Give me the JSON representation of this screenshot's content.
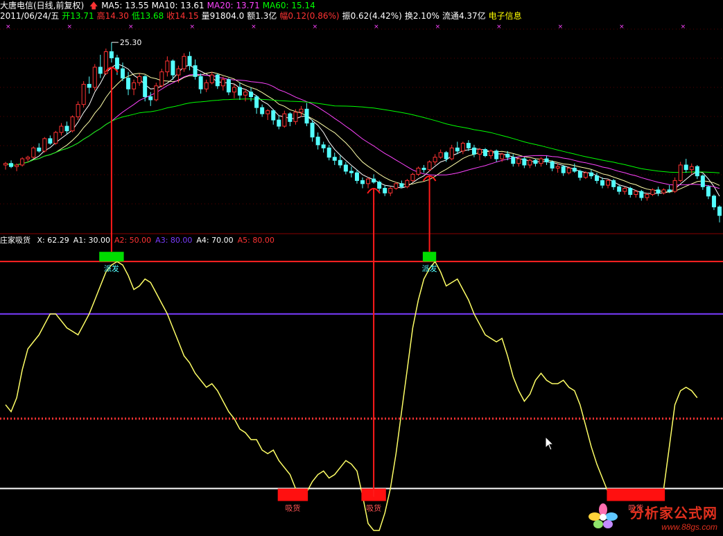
{
  "header": {
    "title": "大唐电信(日线,前复权)",
    "ma": [
      {
        "label": "MA5: 13.55",
        "color": "#ffffff"
      },
      {
        "label": "MA10: 13.61",
        "color": "#ffffff"
      },
      {
        "label": "MA20: 13.71",
        "color": "#ff44ff"
      },
      {
        "label": "MA60: 15.14",
        "color": "#00ff00"
      }
    ],
    "quote": [
      {
        "label": "2011/06/24/五",
        "color": "#ffffff"
      },
      {
        "label": "开13.71",
        "color": "#00ff00"
      },
      {
        "label": "高14.30",
        "color": "#ff3333"
      },
      {
        "label": "低13.68",
        "color": "#00ff00"
      },
      {
        "label": "收14.15",
        "color": "#ff3333"
      },
      {
        "label": "量91804.0",
        "color": "#ffffff"
      },
      {
        "label": "额1.3亿",
        "color": "#ffffff"
      },
      {
        "label": "幅0.12(0.86%)",
        "color": "#ff3333"
      },
      {
        "label": "振0.62(4.42%)",
        "color": "#ffffff"
      },
      {
        "label": "换2.10%",
        "color": "#ffffff"
      },
      {
        "label": "流通4.37亿",
        "color": "#ffffff"
      },
      {
        "label": "电子信息",
        "color": "#ffff00"
      }
    ],
    "peak_label": "25.30"
  },
  "indicator": {
    "title": "庄家吸货",
    "params": [
      {
        "label": "X: 62.29",
        "color": "#ffffff"
      },
      {
        "label": "A1: 30.00",
        "color": "#ffffff"
      },
      {
        "label": "A2: 50.00",
        "color": "#ff3333"
      },
      {
        "label": "A3: 80.00",
        "color": "#7b3cff"
      },
      {
        "label": "A4: 70.00",
        "color": "#ffffff"
      },
      {
        "label": "A5: 80.00",
        "color": "#ff3333"
      }
    ]
  },
  "signals": {
    "sell_text": "派发",
    "buy_text": "吸货"
  },
  "watermark": {
    "name": "分析家公式网",
    "url": "www.88gs.com"
  },
  "chart_data": {
    "type": "candlestick",
    "candles": [
      [
        17.4,
        17.6,
        17.1,
        17.5
      ],
      [
        17.5,
        17.7,
        17.2,
        17.3
      ],
      [
        17.3,
        17.5,
        17.0,
        17.4
      ],
      [
        17.4,
        17.9,
        17.3,
        17.8
      ],
      [
        17.8,
        18.0,
        17.6,
        17.9
      ],
      [
        17.9,
        18.6,
        17.8,
        18.5
      ],
      [
        18.5,
        18.8,
        18.2,
        18.3
      ],
      [
        18.3,
        19.2,
        18.2,
        19.1
      ],
      [
        19.1,
        19.3,
        18.7,
        18.8
      ],
      [
        18.8,
        19.6,
        18.7,
        19.5
      ],
      [
        19.5,
        20.1,
        19.3,
        19.9
      ],
      [
        19.9,
        20.2,
        19.4,
        19.6
      ],
      [
        19.6,
        20.6,
        19.5,
        20.5
      ],
      [
        20.5,
        21.5,
        20.3,
        21.3
      ],
      [
        21.3,
        22.8,
        21.1,
        22.6
      ],
      [
        22.6,
        23.1,
        22.0,
        22.4
      ],
      [
        22.4,
        23.9,
        22.2,
        23.7
      ],
      [
        23.7,
        24.5,
        23.0,
        23.3
      ],
      [
        23.3,
        24.9,
        23.2,
        24.7
      ],
      [
        24.7,
        25.3,
        24.0,
        24.3
      ],
      [
        24.3,
        24.5,
        23.2,
        23.6
      ],
      [
        23.6,
        24.0,
        22.8,
        23.0
      ],
      [
        23.0,
        23.4,
        21.9,
        22.3
      ],
      [
        22.3,
        22.9,
        21.9,
        22.7
      ],
      [
        22.7,
        23.3,
        22.5,
        23.1
      ],
      [
        23.1,
        23.2,
        21.5,
        21.8
      ],
      [
        21.8,
        22.1,
        21.2,
        21.6
      ],
      [
        21.6,
        22.7,
        21.5,
        22.5
      ],
      [
        22.5,
        23.6,
        22.4,
        23.4
      ],
      [
        23.4,
        24.4,
        23.1,
        24.1
      ],
      [
        24.1,
        24.2,
        22.9,
        23.2
      ],
      [
        23.2,
        23.8,
        22.7,
        23.6
      ],
      [
        23.6,
        24.6,
        23.4,
        24.4
      ],
      [
        24.4,
        24.7,
        23.5,
        23.8
      ],
      [
        23.8,
        24.2,
        22.9,
        23.1
      ],
      [
        23.1,
        23.3,
        22.0,
        22.3
      ],
      [
        22.3,
        22.9,
        22.1,
        22.7
      ],
      [
        22.7,
        23.4,
        22.6,
        23.2
      ],
      [
        23.2,
        23.3,
        22.3,
        22.5
      ],
      [
        22.5,
        23.1,
        22.2,
        22.9
      ],
      [
        22.9,
        23.0,
        21.9,
        22.1
      ],
      [
        22.1,
        22.6,
        21.7,
        22.4
      ],
      [
        22.4,
        22.7,
        21.6,
        21.9
      ],
      [
        21.9,
        22.3,
        21.5,
        22.1
      ],
      [
        22.1,
        22.4,
        21.5,
        21.8
      ],
      [
        21.8,
        21.9,
        20.7,
        21.1
      ],
      [
        21.1,
        21.3,
        20.5,
        20.7
      ],
      [
        20.7,
        21.0,
        20.3,
        20.9
      ],
      [
        20.9,
        21.0,
        20.0,
        20.3
      ],
      [
        20.3,
        20.6,
        19.7,
        19.9
      ],
      [
        19.9,
        20.9,
        19.8,
        20.7
      ],
      [
        20.7,
        20.8,
        19.9,
        20.2
      ],
      [
        20.2,
        21.0,
        20.0,
        20.8
      ],
      [
        20.8,
        21.2,
        20.5,
        21.0
      ],
      [
        21.0,
        21.4,
        19.9,
        20.1
      ],
      [
        20.1,
        20.3,
        18.9,
        19.2
      ],
      [
        19.2,
        19.5,
        18.4,
        18.7
      ],
      [
        18.7,
        18.9,
        18.2,
        18.5
      ],
      [
        18.5,
        18.7,
        17.7,
        17.9
      ],
      [
        17.9,
        18.2,
        17.4,
        17.7
      ],
      [
        17.7,
        18.0,
        17.2,
        17.4
      ],
      [
        17.4,
        17.6,
        16.8,
        17.0
      ],
      [
        17.0,
        17.3,
        16.6,
        16.9
      ],
      [
        16.9,
        17.1,
        16.2,
        16.4
      ],
      [
        16.4,
        16.6,
        15.9,
        16.2
      ],
      [
        16.2,
        16.6,
        15.9,
        16.5
      ],
      [
        16.5,
        16.8,
        16.2,
        16.3
      ],
      [
        16.3,
        16.4,
        15.7,
        15.9
      ],
      [
        15.9,
        16.1,
        15.4,
        15.6
      ],
      [
        15.6,
        16.0,
        15.4,
        15.9
      ],
      [
        15.9,
        16.3,
        15.8,
        16.2
      ],
      [
        16.2,
        16.4,
        15.9,
        16.0
      ],
      [
        16.0,
        16.5,
        15.9,
        16.4
      ],
      [
        16.4,
        16.9,
        16.3,
        16.8
      ],
      [
        16.8,
        17.3,
        16.7,
        17.2
      ],
      [
        17.2,
        17.4,
        16.9,
        17.1
      ],
      [
        17.1,
        17.7,
        17.0,
        17.6
      ],
      [
        17.6,
        18.1,
        17.4,
        17.9
      ],
      [
        17.9,
        18.4,
        17.8,
        18.2
      ],
      [
        18.2,
        18.3,
        17.6,
        17.8
      ],
      [
        17.8,
        18.7,
        17.7,
        18.5
      ],
      [
        18.5,
        18.9,
        18.1,
        18.3
      ],
      [
        18.3,
        18.9,
        18.1,
        18.8
      ],
      [
        18.8,
        19.0,
        18.3,
        18.5
      ],
      [
        18.5,
        18.7,
        17.9,
        18.1
      ],
      [
        18.1,
        18.5,
        17.7,
        18.4
      ],
      [
        18.4,
        18.5,
        17.9,
        18.0
      ],
      [
        18.0,
        18.4,
        17.8,
        18.3
      ],
      [
        18.3,
        18.4,
        17.6,
        17.8
      ],
      [
        17.8,
        18.2,
        17.6,
        18.1
      ],
      [
        18.1,
        18.3,
        17.7,
        17.9
      ],
      [
        17.9,
        18.1,
        17.3,
        17.5
      ],
      [
        17.5,
        17.9,
        17.3,
        17.8
      ],
      [
        17.8,
        17.9,
        17.2,
        17.4
      ],
      [
        17.4,
        17.8,
        17.2,
        17.7
      ],
      [
        17.7,
        17.8,
        17.3,
        17.5
      ],
      [
        17.5,
        17.9,
        17.3,
        17.8
      ],
      [
        17.8,
        18.0,
        17.4,
        17.6
      ],
      [
        17.6,
        17.7,
        17.0,
        17.2
      ],
      [
        17.2,
        17.5,
        16.9,
        17.3
      ],
      [
        17.3,
        17.4,
        16.7,
        16.9
      ],
      [
        16.9,
        17.3,
        16.8,
        17.2
      ],
      [
        17.2,
        17.5,
        16.9,
        17.0
      ],
      [
        17.0,
        17.1,
        16.4,
        16.6
      ],
      [
        16.6,
        17.0,
        16.5,
        16.9
      ],
      [
        16.9,
        17.1,
        16.5,
        16.7
      ],
      [
        16.7,
        16.9,
        16.2,
        16.4
      ],
      [
        16.4,
        16.6,
        15.9,
        16.1
      ],
      [
        16.1,
        16.5,
        15.9,
        16.4
      ],
      [
        16.4,
        16.5,
        15.8,
        16.0
      ],
      [
        16.0,
        16.1,
        15.5,
        15.7
      ],
      [
        15.7,
        16.0,
        15.5,
        15.9
      ],
      [
        15.9,
        16.0,
        15.3,
        15.5
      ],
      [
        15.5,
        15.8,
        15.3,
        15.7
      ],
      [
        15.7,
        15.8,
        15.1,
        15.3
      ],
      [
        15.3,
        15.6,
        15.1,
        15.5
      ],
      [
        15.5,
        15.9,
        15.4,
        15.8
      ],
      [
        15.8,
        16.0,
        15.4,
        15.6
      ],
      [
        15.6,
        15.9,
        15.5,
        15.8
      ],
      [
        15.8,
        16.1,
        15.6,
        15.7
      ],
      [
        15.7,
        16.6,
        15.6,
        16.4
      ],
      [
        16.4,
        17.6,
        16.3,
        17.4
      ],
      [
        17.4,
        17.8,
        16.9,
        17.1
      ],
      [
        17.1,
        17.5,
        16.8,
        17.3
      ],
      [
        17.3,
        17.4,
        16.5,
        16.7
      ],
      [
        16.7,
        16.8,
        15.8,
        16.0
      ],
      [
        16.0,
        16.1,
        15.2,
        15.4
      ],
      [
        15.4,
        15.5,
        14.5,
        14.7
      ],
      [
        14.7,
        14.8,
        13.7,
        14.15
      ]
    ],
    "ma": [
      {
        "name": "MA5",
        "color": "#ffffff",
        "period": 5
      },
      {
        "name": "MA10",
        "color": "#ffffaa",
        "period": 10
      },
      {
        "name": "MA20",
        "color": "#ff44ff",
        "period": 20
      },
      {
        "name": "MA60",
        "color": "#00ff00",
        "period": 60
      }
    ],
    "ylim": [
      13.2,
      26.6
    ],
    "indicator_values": [
      54,
      52,
      56,
      64,
      70,
      72,
      74,
      77,
      80,
      80,
      78,
      76,
      75,
      74,
      77,
      80,
      84,
      88,
      92,
      94,
      95,
      94,
      91,
      87,
      88,
      90,
      89,
      86,
      83,
      80,
      76,
      72,
      68,
      66,
      63,
      61,
      59,
      60,
      58,
      55,
      52,
      50,
      47,
      46,
      44,
      44,
      41,
      40,
      41,
      38,
      36,
      34,
      30,
      29,
      29,
      32,
      34,
      35,
      33,
      34,
      36,
      38,
      37,
      35,
      28,
      20,
      18,
      18,
      23,
      30,
      40,
      52,
      64,
      76,
      84,
      90,
      93,
      95,
      92,
      88,
      89,
      90,
      87,
      84,
      80,
      77,
      74,
      73,
      72,
      73,
      68,
      62,
      58,
      55,
      57,
      61,
      63,
      61,
      60,
      60,
      61,
      59,
      58,
      54,
      48,
      42,
      37,
      33,
      29,
      28,
      29,
      28,
      27,
      27,
      27,
      27,
      27,
      27,
      30,
      42,
      54,
      58,
      59,
      58,
      56
    ],
    "indicator_ylim": [
      17,
      100
    ],
    "levels": [
      {
        "name": "A1",
        "value": 30,
        "color": "#ffffff",
        "style": "solid"
      },
      {
        "name": "A2",
        "value": 50,
        "color": "#ff3333",
        "style": "dotted"
      },
      {
        "name": "A3",
        "value": 80,
        "color": "#7b3cff",
        "style": "solid"
      },
      {
        "name": "A5",
        "value": 95,
        "color": "#ff2222",
        "style": "solid"
      }
    ],
    "signal_markers": [
      {
        "kind": "sell",
        "start": 18,
        "end": 20
      },
      {
        "kind": "sell",
        "start": 76,
        "end": 76
      },
      {
        "kind": "buy",
        "start": 50,
        "end": 53
      },
      {
        "kind": "buy",
        "start": 65,
        "end": 67
      },
      {
        "kind": "buy",
        "start": 109,
        "end": 117
      }
    ],
    "arrows": [
      {
        "candle": 19,
        "from": "indicator",
        "to": "price"
      },
      {
        "candle": 66,
        "from": "indicator",
        "to": "price"
      },
      {
        "candle": 76,
        "from": "indicator",
        "to": "price"
      }
    ]
  }
}
